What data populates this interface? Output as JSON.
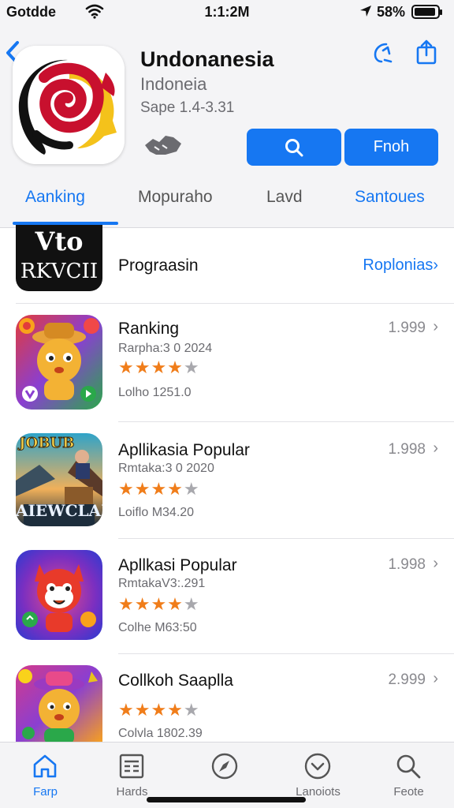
{
  "status_bar": {
    "carrier": "Gotdde",
    "time": "1:1:2M",
    "battery_pct": "58%"
  },
  "app": {
    "title": "Undonanesia",
    "subtitle": "Indoneia",
    "meta": "Sape 1.4-3.31",
    "search_button_icon": "search-icon",
    "primary_button_label": "Fnoh"
  },
  "tabs": [
    {
      "label": "Aanking",
      "active": true
    },
    {
      "label": "Mopuraho",
      "active": false
    },
    {
      "label": "Lavd",
      "active": false
    },
    {
      "label": "Santoues",
      "active": false
    }
  ],
  "first_row": {
    "icon_text_top": "Vto",
    "icon_text_bottom": "RKVCII",
    "name": "Prograasin",
    "link": "Roplonias›"
  },
  "rows": [
    {
      "name": "Ranking",
      "subtitle": "Rarpha:3 0 2024",
      "rating": 4,
      "stars_filled": "★★★★",
      "stars_empty": "★",
      "size": "Lolho  1251.0",
      "price": "1.999"
    },
    {
      "name": "Apllikasia Popular",
      "subtitle": "Rmtaka:3 0 2020",
      "rating": 4,
      "stars_filled": "★★★★",
      "stars_empty": "★",
      "size": "Loiflo  M34.20",
      "price": "1.998",
      "icon_text": "AIEWCLAI",
      "icon_top_text": "JOBUB"
    },
    {
      "name": "Apllkasi Popular",
      "subtitle": "RmtakaV3:.291",
      "rating": 4,
      "stars_filled": "★★★★",
      "stars_empty": "★",
      "size": "Colhe  M63:50",
      "price": "1.998"
    },
    {
      "name": "Collkoh Saaplla",
      "subtitle": "",
      "rating": 4,
      "stars_filled": "★★★★",
      "stars_empty": "★",
      "size": "Colvla  1802.39",
      "price": "2.999"
    }
  ],
  "chevron": "›",
  "tab_bar": [
    {
      "label": "Farp",
      "icon": "house-icon",
      "active": true
    },
    {
      "label": "Hards",
      "icon": "list-icon",
      "active": false
    },
    {
      "label": "",
      "icon": "compass-icon",
      "active": false
    },
    {
      "label": "Lanoiots",
      "icon": "heart-icon",
      "active": false
    },
    {
      "label": "Feote",
      "icon": "search-icon",
      "active": false
    }
  ],
  "colors": {
    "accent": "#1677f2",
    "star": "#f07d1a",
    "header_bg": "#f4f4f6"
  }
}
